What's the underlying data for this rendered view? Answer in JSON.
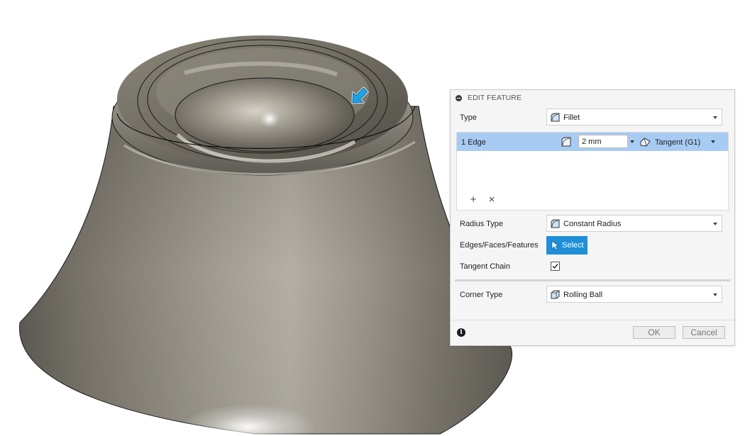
{
  "dialog": {
    "title": "EDIT FEATURE",
    "type": {
      "label": "Type",
      "value": "Fillet"
    },
    "edge_selection": {
      "label": "1 Edge",
      "radius_value": "2 mm",
      "continuity": "Tangent (G1)",
      "add_icon": "plus-icon",
      "remove_icon": "close-icon"
    },
    "radius_type": {
      "label": "Radius Type",
      "value": "Constant Radius"
    },
    "edges": {
      "label": "Edges/Faces/Features",
      "button": "Select"
    },
    "tangent_chain": {
      "label": "Tangent Chain",
      "checked": true
    },
    "corner_type": {
      "label": "Corner Type",
      "value": "Rolling Ball"
    },
    "ok_label": "OK",
    "cancel_label": "Cancel"
  },
  "colors": {
    "selected_row": "#a8cbf3",
    "select_button": "#1e8fd8",
    "model_surface": "#6b6659",
    "dialog_bg": "#f5f5f5"
  }
}
